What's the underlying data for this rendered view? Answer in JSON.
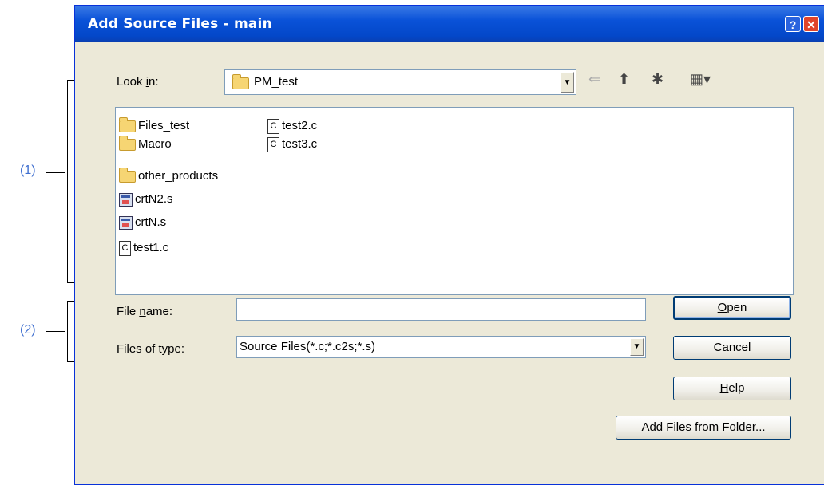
{
  "callouts": [
    {
      "label": "(1)"
    },
    {
      "label": "(2)"
    }
  ],
  "window": {
    "title": "Add Source Files - main",
    "help_button": "?",
    "close_button": "✕"
  },
  "look_in": {
    "label_prefix": "Look ",
    "label_mnemonic": "i",
    "label_suffix": "n:",
    "value": "PM_test"
  },
  "toolbar": {
    "back_icon": "back-arrow-icon",
    "up_icon": "up-folder-icon",
    "new_folder_icon": "new-folder-icon",
    "view_menu_icon": "view-menu-icon"
  },
  "files": [
    {
      "name": "Files_test",
      "kind": "folder"
    },
    {
      "name": "Macro",
      "kind": "folder"
    },
    {
      "name": "other_products",
      "kind": "folder"
    },
    {
      "name": "crtN2.s",
      "kind": "asm"
    },
    {
      "name": "crtN.s",
      "kind": "asm"
    },
    {
      "name": "test1.c",
      "kind": "c"
    },
    {
      "name": "test2.c",
      "kind": "c"
    },
    {
      "name": "test3.c",
      "kind": "c"
    }
  ],
  "file_name": {
    "label_prefix": "File ",
    "label_mnemonic": "n",
    "label_suffix": "ame:",
    "value": ""
  },
  "file_type": {
    "label": "Files of type:",
    "value": "Source Files(*.c;*.c2s;*.s)"
  },
  "buttons": {
    "open_mnemonic": "O",
    "open_rest": "pen",
    "cancel": "Cancel",
    "help_mnemonic": "H",
    "help_rest": "elp",
    "add_prefix": "Add Files from ",
    "add_mnemonic": "F",
    "add_rest": "older..."
  },
  "colors": {
    "titlebar": "#0a52d8",
    "callout_text": "#3f6fd0",
    "dialog_bg": "#ece9d8"
  }
}
